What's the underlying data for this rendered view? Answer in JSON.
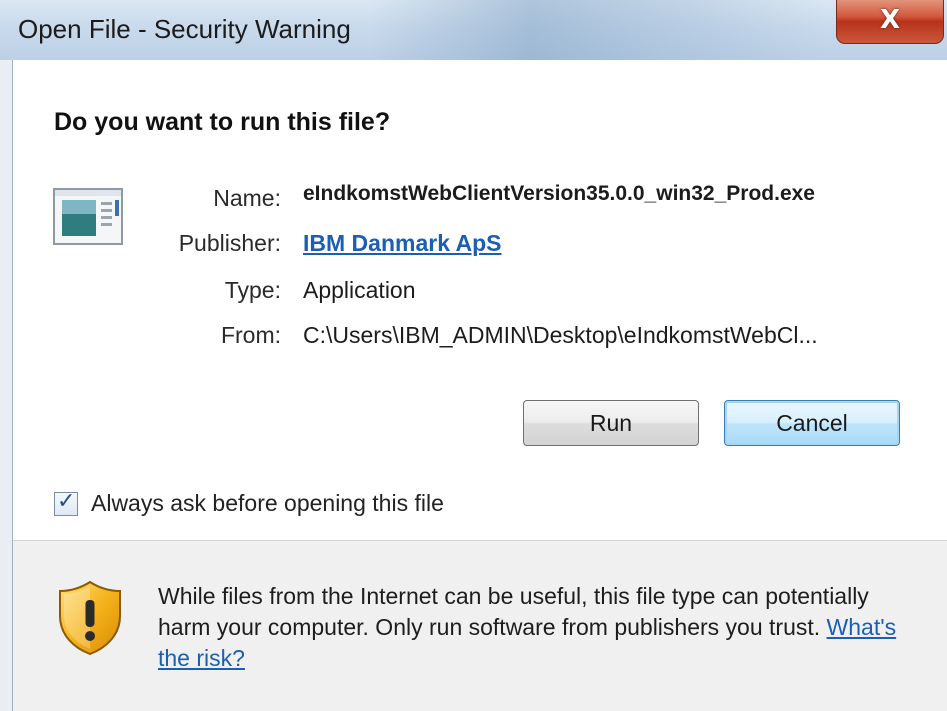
{
  "window": {
    "title": "Open File - Security Warning",
    "close_glyph": "X"
  },
  "dialog": {
    "heading": "Do you want to run this file?",
    "icon": "application-window-icon",
    "fields": {
      "name_label": "Name:",
      "name_value": "eIndkomstWebClientVersion35.0.0_win32_Prod.exe",
      "publisher_label": "Publisher:",
      "publisher_value": "IBM Danmark ApS",
      "type_label": "Type:",
      "type_value": "Application",
      "from_label": "From:",
      "from_value": "C:\\Users\\IBM_ADMIN\\Desktop\\eIndkomstWebCl..."
    },
    "buttons": {
      "run_label": "Run",
      "cancel_label": "Cancel"
    },
    "checkbox": {
      "label": "Always ask before opening this file",
      "checked": true
    }
  },
  "warning": {
    "icon": "shield-warning-icon",
    "text": "While files from the Internet can be useful, this file type can potentially harm your computer. Only run software from publishers you trust.",
    "link_label": "What's the risk?"
  },
  "colors": {
    "link": "#1a5fb4",
    "close_button": "#c8452b",
    "titlebar": "#c9daec"
  }
}
